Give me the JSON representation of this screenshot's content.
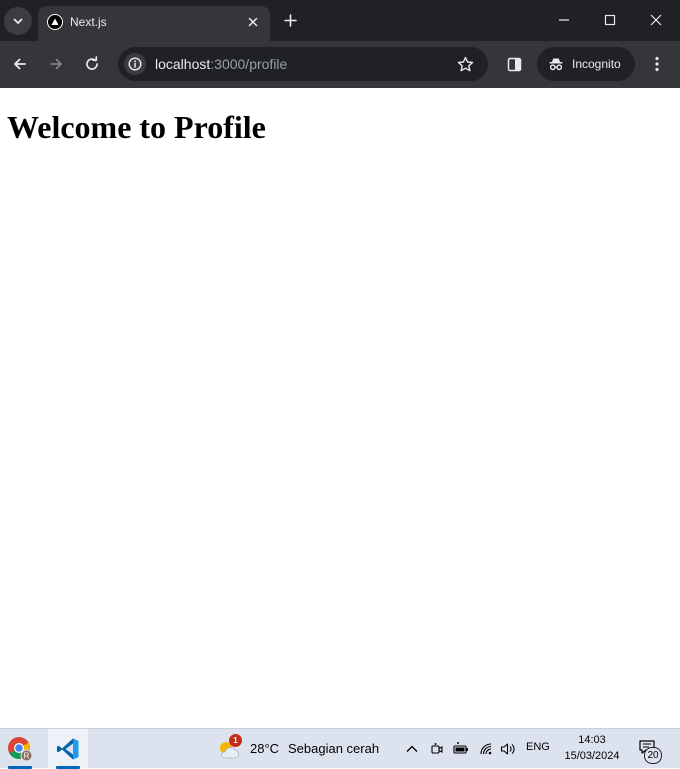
{
  "browser": {
    "tab": {
      "title": "Next.js"
    },
    "address": {
      "host": "localhost",
      "rest": ":3000/profile"
    },
    "incognito_label": "Incognito",
    "theme": {
      "frame": "#202124",
      "toolbar": "#35363a",
      "text": "#e8eaed"
    }
  },
  "page": {
    "heading": "Welcome to Profile"
  },
  "taskbar": {
    "apps": [
      {
        "name": "chrome-app-icon"
      },
      {
        "name": "vscode-app-icon"
      }
    ],
    "weather": {
      "badge": "1",
      "temperature": "28°C",
      "condition": "Sebagian cerah"
    },
    "tray": {
      "language": "ENG",
      "time": "14:03",
      "date": "15/03/2024",
      "notification_count": "20"
    }
  }
}
